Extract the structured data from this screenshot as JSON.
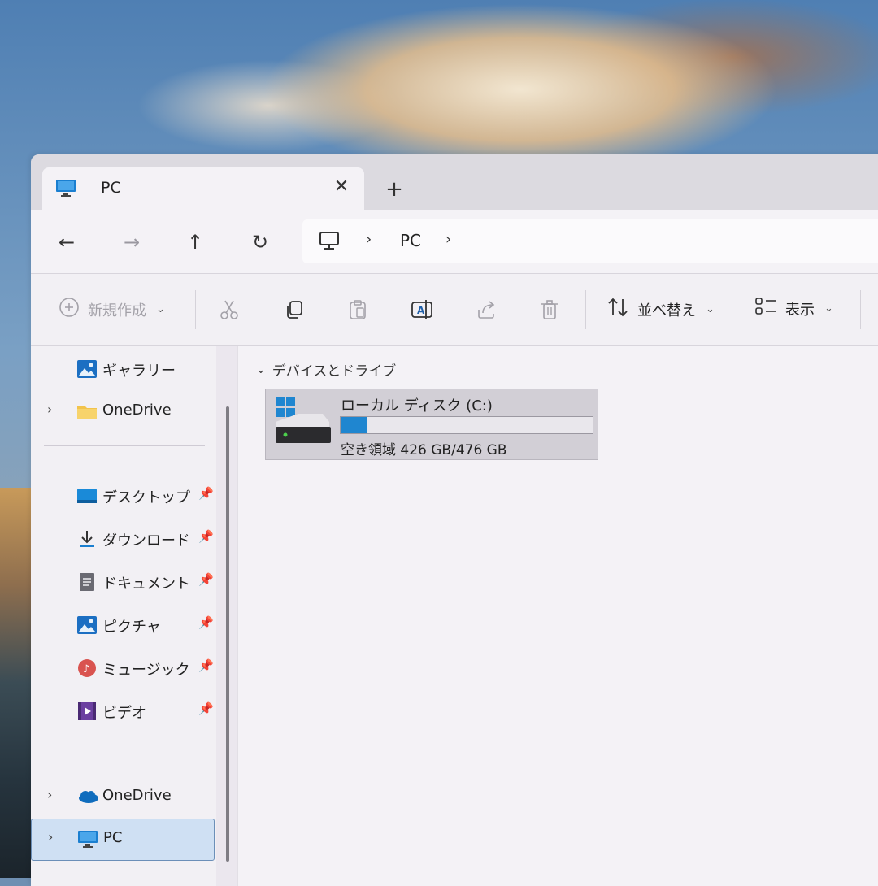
{
  "window": {
    "tab": {
      "title": "PC",
      "close": "✕"
    },
    "new_tab": "+"
  },
  "nav": {
    "back": "←",
    "forward": "→",
    "up": "↑",
    "refresh": "↻",
    "breadcrumb": [
      "PC"
    ],
    "sep": "›"
  },
  "toolbar": {
    "new_label": "新規作成",
    "sort_label": "並べ替え",
    "view_label": "表示"
  },
  "sidebar": {
    "items": [
      {
        "label": "ギャラリー",
        "icon": "gallery-icon"
      },
      {
        "label": "OneDrive",
        "icon": "folder-icon",
        "expandable": true
      },
      {
        "label": "デスクトップ",
        "icon": "desktop-icon",
        "pinned": true
      },
      {
        "label": "ダウンロード",
        "icon": "download-icon",
        "pinned": true
      },
      {
        "label": "ドキュメント",
        "icon": "document-icon",
        "pinned": true
      },
      {
        "label": "ピクチャ",
        "icon": "pictures-icon",
        "pinned": true
      },
      {
        "label": "ミュージック",
        "icon": "music-icon",
        "pinned": true
      },
      {
        "label": "ビデオ",
        "icon": "video-icon",
        "pinned": true
      },
      {
        "label": "OneDrive",
        "icon": "cloud-icon",
        "expandable": true
      },
      {
        "label": "PC",
        "icon": "monitor-icon",
        "expandable": true,
        "selected": true
      }
    ]
  },
  "content": {
    "group_header": "デバイスとドライブ",
    "drives": [
      {
        "name": "ローカル ディスク (C:)",
        "free_text": "空き領域 426 GB/476 GB",
        "used_fraction": 0.105
      }
    ]
  },
  "colors": {
    "accent": "#1f86d0",
    "selection": "#cfe0f3"
  }
}
